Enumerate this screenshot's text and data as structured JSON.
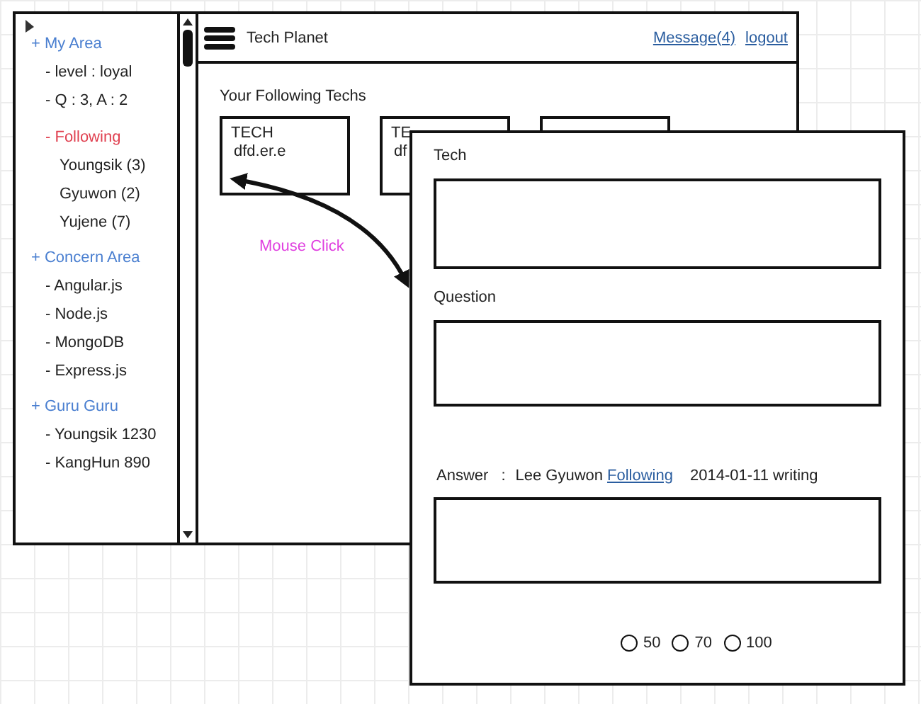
{
  "window": {
    "title": "Tech Planet",
    "links": [
      "Message(4)",
      "logout"
    ]
  },
  "sidebar": {
    "items": [
      {
        "kind": "heading",
        "text": "+ My Area"
      },
      {
        "kind": "entry",
        "text": "- level : loyal"
      },
      {
        "kind": "entry",
        "text": "- Q : 3, A : 2"
      },
      {
        "kind": "accent",
        "text": "- Following",
        "children": [
          {
            "kind": "sub",
            "text": "Youngsik (3)"
          },
          {
            "kind": "sub",
            "text": "Gyuwon (2)"
          },
          {
            "kind": "sub",
            "text": "Yujene (7)"
          }
        ]
      },
      {
        "kind": "heading",
        "text": "+ Concern Area"
      },
      {
        "kind": "entry",
        "text": "- Angular.js"
      },
      {
        "kind": "entry",
        "text": "- Node.js"
      },
      {
        "kind": "entry",
        "text": "- MongoDB"
      },
      {
        "kind": "entry",
        "text": "- Express.js"
      },
      {
        "kind": "heading",
        "text": "+ Guru Guru"
      },
      {
        "kind": "entry",
        "text": "- Youngsik 1230"
      },
      {
        "kind": "entry",
        "text": "- KangHun 890"
      }
    ]
  },
  "content": {
    "heading": "Your Following Techs",
    "cards": [
      {
        "kind": "text",
        "title": "TECH",
        "body": "dfd.er.e"
      },
      {
        "kind": "text",
        "title": "TE",
        "body": "df"
      },
      {
        "kind": "blank"
      }
    ],
    "annotation": "Mouse Click"
  },
  "dialog": {
    "tech_label": "Tech",
    "question_label": "Question",
    "answer": {
      "label": "Answer",
      "separator": ":",
      "author": "Lee Gyuwon",
      "link": "Following",
      "date": "2014-01-11 writing"
    },
    "ratings": [
      {
        "label": "50",
        "selected": false
      },
      {
        "label": "70",
        "selected": false
      },
      {
        "label": "100",
        "selected": false
      }
    ]
  }
}
